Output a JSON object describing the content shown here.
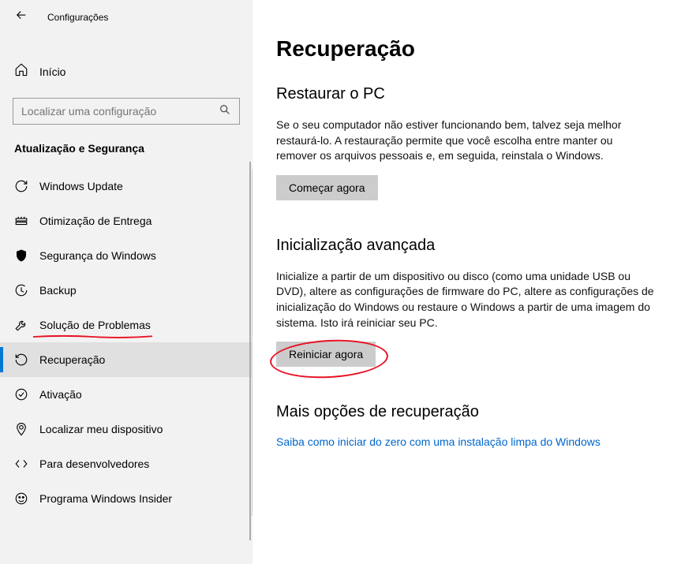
{
  "header": {
    "app_title": "Configurações"
  },
  "sidebar": {
    "home_label": "Início",
    "search_placeholder": "Localizar uma configuração",
    "section_title": "Atualização e Segurança",
    "items": [
      {
        "label": "Windows Update"
      },
      {
        "label": "Otimização de Entrega"
      },
      {
        "label": "Segurança do Windows"
      },
      {
        "label": "Backup"
      },
      {
        "label": "Solução de Problemas"
      },
      {
        "label": "Recuperação"
      },
      {
        "label": "Ativação"
      },
      {
        "label": "Localizar meu dispositivo"
      },
      {
        "label": "Para desenvolvedores"
      },
      {
        "label": "Programa Windows Insider"
      }
    ]
  },
  "main": {
    "page_title": "Recuperação",
    "section1": {
      "heading": "Restaurar o PC",
      "body": "Se o seu computador não estiver funcionando bem, talvez seja melhor restaurá-lo. A restauração permite que você escolha entre manter ou remover os arquivos pessoais e, em seguida, reinstala o Windows.",
      "button": "Começar agora"
    },
    "section2": {
      "heading": "Inicialização avançada",
      "body": "Inicialize a partir de um dispositivo ou disco (como uma unidade USB ou DVD), altere as configurações de firmware do PC, altere as configurações de inicialização do Windows ou restaure o Windows a partir de uma imagem do sistema. Isto irá reiniciar seu PC.",
      "button": "Reiniciar agora"
    },
    "section3": {
      "heading": "Mais opções de recuperação",
      "link": "Saiba como iniciar do zero com uma instalação limpa do Windows"
    }
  },
  "annotation": {
    "color": "#e81123"
  }
}
